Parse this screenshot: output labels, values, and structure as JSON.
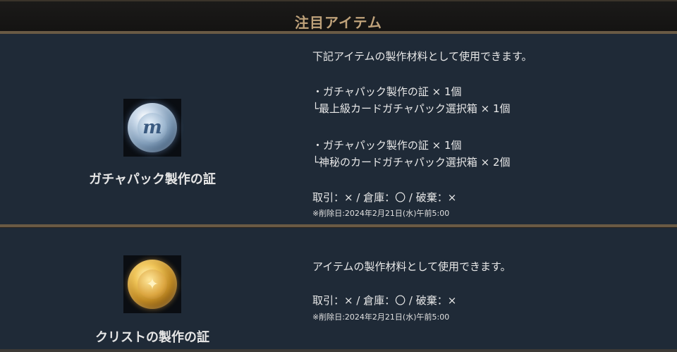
{
  "header": {
    "title": "注目アイテム"
  },
  "items": [
    {
      "name": "ガチャパック製作の証",
      "icon": "silver-coin-icon",
      "icon_glyph": "m",
      "description": [
        "下記アイテムの製作材料として使用できます。",
        "・ガチャパック製作の証 × 1個",
        "└最上級カードガチャパック選択箱 × 1個",
        "・ガチャパック製作の証 × 1個",
        "└神秘のカードガチャパック選択箱 × 2個"
      ],
      "trade": "取引：× / 倉庫：〇 / 破棄：×",
      "delete_note": "※削除日:2024年2月21日(水)午前5:00"
    },
    {
      "name": "クリストの製作の証",
      "icon": "gold-coin-icon",
      "icon_glyph": "✦",
      "description": [
        "アイテムの製作材料として使用できます。"
      ],
      "trade": "取引：× / 倉庫：〇 / 破棄：×",
      "delete_note": "※削除日:2024年2月21日(水)午前5:00"
    }
  ],
  "colors": {
    "header_text": "#bfa27a",
    "background": "#1f2a37",
    "divider": "#6a5a44"
  }
}
